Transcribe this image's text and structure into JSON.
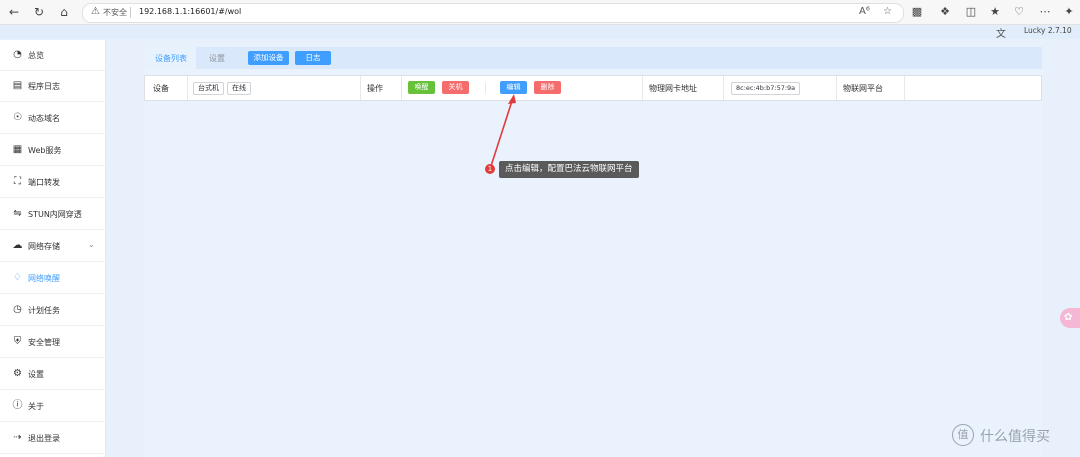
{
  "browser": {
    "security_label": "不安全",
    "url": "192.168.1.1:16601/#/wol"
  },
  "app": {
    "version": "Lucky 2.7.10"
  },
  "sidebar": {
    "items": [
      {
        "label": "总览",
        "icon": "gauge-icon"
      },
      {
        "label": "程序日志",
        "icon": "document-icon"
      },
      {
        "label": "动态域名",
        "icon": "globe-icon"
      },
      {
        "label": "Web服务",
        "icon": "window-icon"
      },
      {
        "label": "端口转发",
        "icon": "expand-icon"
      },
      {
        "label": "STUN内网穿透",
        "icon": "network-icon"
      },
      {
        "label": "网络存储",
        "icon": "cloud-icon"
      },
      {
        "label": "网络唤醒",
        "icon": "bell-icon"
      },
      {
        "label": "计划任务",
        "icon": "clock-icon"
      },
      {
        "label": "安全管理",
        "icon": "shield-icon"
      },
      {
        "label": "设置",
        "icon": "gear-icon"
      },
      {
        "label": "关于",
        "icon": "info-icon"
      },
      {
        "label": "退出登录",
        "icon": "logout-icon"
      }
    ],
    "active_index": 7
  },
  "main": {
    "tabs": [
      {
        "label": "设备列表",
        "active": true
      },
      {
        "label": "设置",
        "active": false
      }
    ],
    "add_device_label": "添加设备",
    "log_label": "日志",
    "device": {
      "device_label": "设备",
      "name": "台式机",
      "status": "在线",
      "operation_label": "操作",
      "wake_label": "唤醒",
      "shutdown_label": "关机",
      "edit_label": "编辑",
      "delete_label": "删除",
      "mac_label": "物理网卡地址",
      "mac_value": "8c:ec:4b:b7:57:9a",
      "iot_label": "物联网平台"
    }
  },
  "annotation": {
    "number": "1",
    "text": "点击编辑，配置巴法云物联网平台"
  },
  "watermark": {
    "logo": "值",
    "text": "什么值得买"
  },
  "colors": {
    "accent": "#409eff",
    "success": "#67c23a",
    "danger": "#f56c6c",
    "annotation": "#e03c3c"
  }
}
